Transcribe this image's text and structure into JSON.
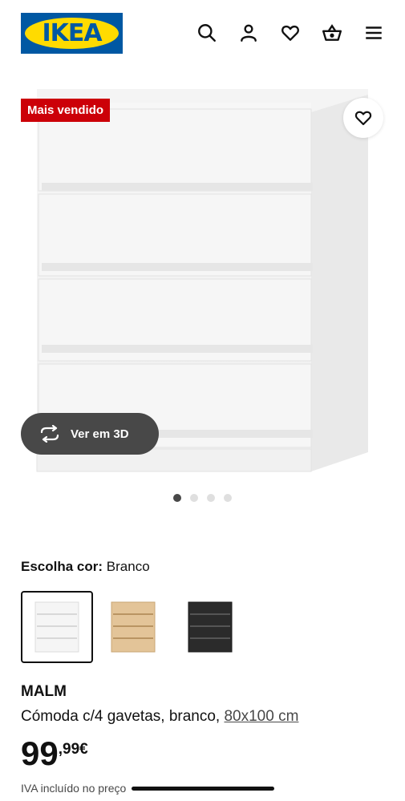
{
  "header": {
    "logo_text": "IKEA",
    "icons": [
      "search-icon",
      "user-icon",
      "heart-icon",
      "basket-icon",
      "menu-icon"
    ]
  },
  "gallery": {
    "badge": "Mais vendido",
    "view_3d_label": "Ver em 3D",
    "image_count": 4,
    "active_image": 1
  },
  "color": {
    "label": "Escolha cor:",
    "selected": "Branco",
    "options": [
      "white",
      "oak",
      "black"
    ]
  },
  "product": {
    "name": "MALM",
    "description": "Cómoda c/4 gavetas, branco, ",
    "size_link": "80x100 cm",
    "price_int": "99",
    "price_dec": ",99€",
    "tax_note": "IVA incluído no preço"
  },
  "colors": {
    "brand_blue": "#0058a3",
    "brand_yellow": "#ffdb00",
    "badge_red": "#cc0008"
  }
}
